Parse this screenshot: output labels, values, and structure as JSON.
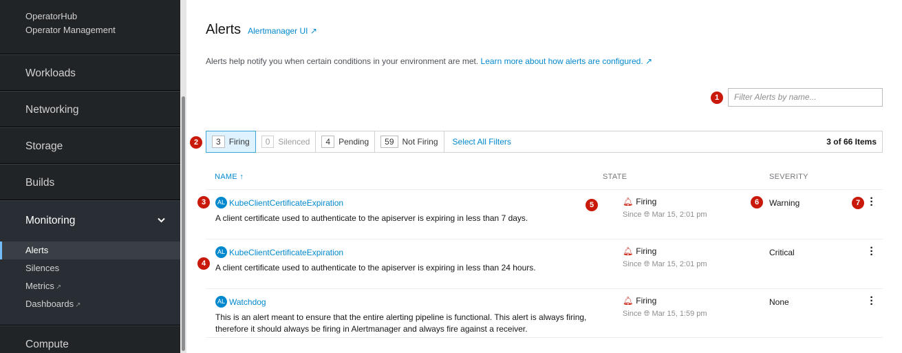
{
  "sidebar": {
    "top_items": [
      "OperatorHub",
      "Operator Management"
    ],
    "sections": {
      "workloads": "Workloads",
      "networking": "Networking",
      "storage": "Storage",
      "builds": "Builds",
      "monitoring": "Monitoring",
      "compute": "Compute"
    },
    "monitoring_items": {
      "alerts": "Alerts",
      "silences": "Silences",
      "metrics": "Metrics",
      "dashboards": "Dashboards"
    },
    "chevron_icon": "chevron-down-icon",
    "external_icon": "external-link-icon"
  },
  "header": {
    "title": "Alerts",
    "alertmanager_link": "Alertmanager UI"
  },
  "description": {
    "text": "Alerts help notify you when certain conditions in your environment are met. ",
    "link": "Learn more about how alerts are configured."
  },
  "filter": {
    "placeholder": "Filter Alerts by name..."
  },
  "filter_bar": {
    "firing": {
      "count": "3",
      "label": "Firing"
    },
    "silenced": {
      "count": "0",
      "label": "Silenced"
    },
    "pending": {
      "count": "4",
      "label": "Pending"
    },
    "not_firing": {
      "count": "59",
      "label": "Not Firing"
    },
    "select_all": "Select All Filters",
    "items_count": "3 of 66 Items"
  },
  "table": {
    "headers": {
      "name": "NAME",
      "state": "STATE",
      "severity": "SEVERITY"
    },
    "sort_icon": "sort-asc-icon",
    "rows": [
      {
        "badge": "AL",
        "name": "KubeClientCertificateExpiration",
        "description": "A client certificate used to authenticate to the apiserver is expiring in less than 7 days.",
        "state": "Firing",
        "since": "Since",
        "time": "Mar 15, 2:01 pm",
        "severity": "Warning"
      },
      {
        "badge": "AL",
        "name": "KubeClientCertificateExpiration",
        "description": "A client certificate used to authenticate to the apiserver is expiring in less than 24 hours.",
        "state": "Firing",
        "since": "Since",
        "time": "Mar 15, 2:01 pm",
        "severity": "Critical"
      },
      {
        "badge": "AL",
        "name": "Watchdog",
        "description": "This is an alert meant to ensure that the entire alerting pipeline is functional. This alert is always firing, therefore it should always be firing in Alertmanager and always fire against a receiver.",
        "state": "Firing",
        "since": "Since",
        "time": "Mar 15, 1:59 pm",
        "severity": "None"
      }
    ]
  },
  "callouts": [
    "1",
    "2",
    "3",
    "4",
    "5",
    "6",
    "7"
  ],
  "colors": {
    "link": "#0088ce",
    "firing": "#c9190b",
    "sidebar_bg": "#212427",
    "callout": "#c9190b"
  }
}
